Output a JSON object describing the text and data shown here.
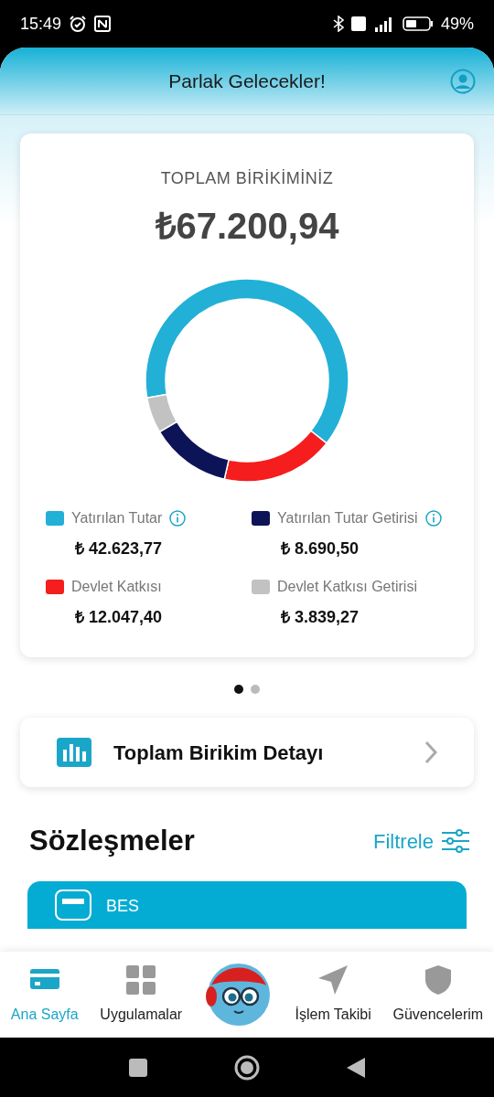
{
  "status_bar": {
    "time": "15:49",
    "battery": "49%"
  },
  "header": {
    "title": "Parlak Gelecekler!"
  },
  "summary_card": {
    "title": "TOPLAM BİRİKİMİNİZ",
    "total": "₺67.200,94",
    "chart_data": {
      "type": "donut",
      "values": [
        63.43,
        17.93,
        12.93,
        5.71
      ]
    },
    "legend": [
      {
        "label": "Yatırılan Tutar",
        "value": "₺ 42.623,77",
        "color": "#22b0d6",
        "info": true
      },
      {
        "label": "Devlet Katkısı",
        "value": "₺ 12.047,40",
        "color": "#f51d1d",
        "info": false
      },
      {
        "label": "Yatırılan Tutar Getirisi",
        "value": "₺ 8.690,50",
        "color": "#0c1457",
        "info": true
      },
      {
        "label": "Devlet Katkısı Getirisi",
        "value": "₺ 3.839,27",
        "color": "#c2c2c2",
        "info": false
      }
    ]
  },
  "pager": [
    {
      "selected": true
    },
    {
      "selected": false
    }
  ],
  "detail_link": {
    "label": "Toplam Birikim Detayı"
  },
  "contracts": {
    "title": "Sözleşmeler",
    "filter": "Filtrele",
    "cards": [
      {
        "label": "BES"
      }
    ]
  },
  "bottom_nav": [
    {
      "label": "Ana Sayfa",
      "kind": "card",
      "selected": true
    },
    {
      "label": "Uygulamalar",
      "kind": "grid",
      "selected": false
    },
    {
      "kind": "mascot",
      "selected": false
    },
    {
      "label": "İşlem Takibi",
      "kind": "send",
      "selected": false
    },
    {
      "label": "Güvencelerim",
      "kind": "shield",
      "selected": false
    }
  ]
}
